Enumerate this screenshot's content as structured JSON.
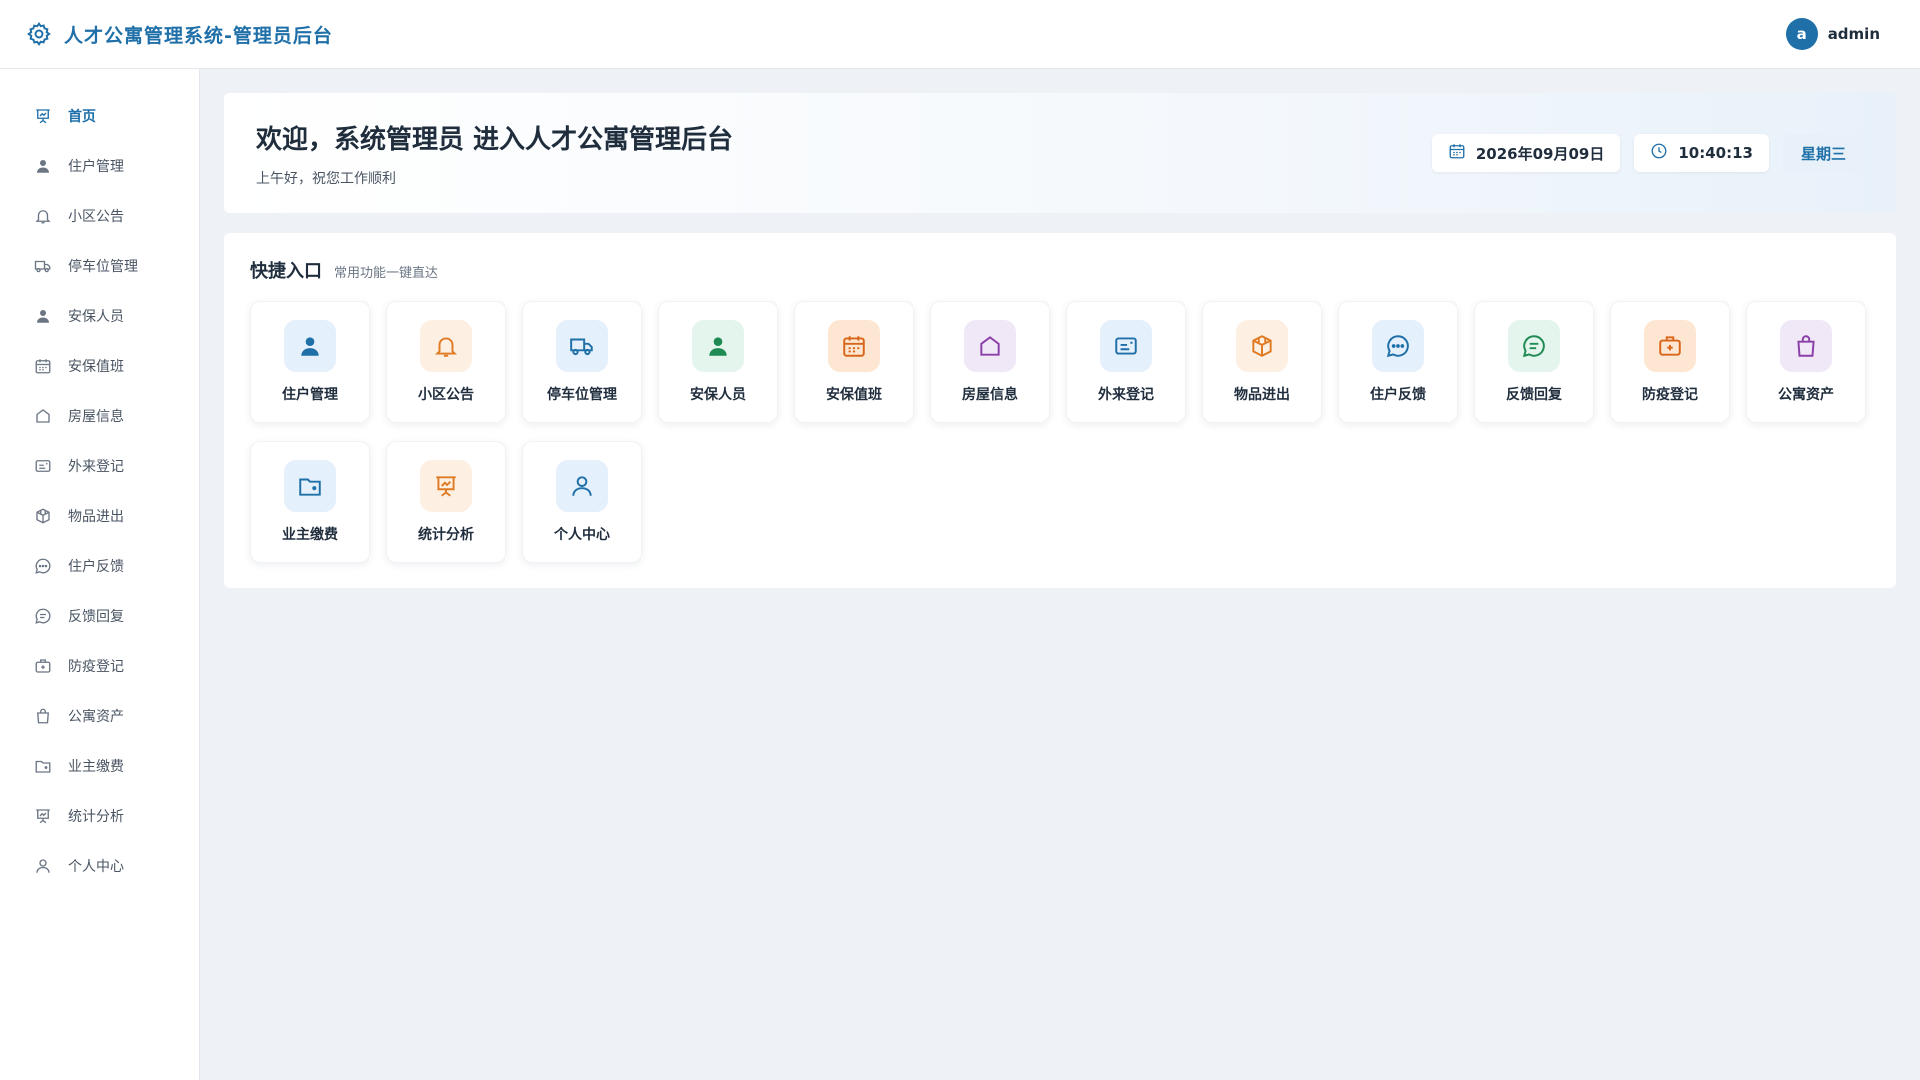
{
  "header": {
    "title": "人才公寓管理系统-管理员后台",
    "avatar_letter": "a",
    "username": "admin"
  },
  "sidebar": {
    "items": [
      {
        "label": "首页",
        "icon": "presentation-icon",
        "active": true
      },
      {
        "label": "住户管理",
        "icon": "user-solid-icon"
      },
      {
        "label": "小区公告",
        "icon": "bell-icon"
      },
      {
        "label": "停车位管理",
        "icon": "truck-icon"
      },
      {
        "label": "安保人员",
        "icon": "user-solid-icon"
      },
      {
        "label": "安保值班",
        "icon": "calendar-icon"
      },
      {
        "label": "房屋信息",
        "icon": "house-icon"
      },
      {
        "label": "外来登记",
        "icon": "id-card-icon"
      },
      {
        "label": "物品进出",
        "icon": "box-icon"
      },
      {
        "label": "住户反馈",
        "icon": "chat-dots-icon"
      },
      {
        "label": "反馈回复",
        "icon": "chat-lines-icon"
      },
      {
        "label": "防疫登记",
        "icon": "medkit-icon"
      },
      {
        "label": "公寓资产",
        "icon": "bag-icon"
      },
      {
        "label": "业主缴费",
        "icon": "wallet-icon"
      },
      {
        "label": "统计分析",
        "icon": "presentation-icon"
      },
      {
        "label": "个人中心",
        "icon": "user-outline-icon"
      }
    ]
  },
  "welcome": {
    "title": "欢迎，系统管理员 进入人才公寓管理后台",
    "subtitle": "上午好，祝您工作顺利",
    "date": "2026年09月09日",
    "time": "10:40:13",
    "weekday": "星期三"
  },
  "quick": {
    "title": "快捷入口",
    "subtitle": "常用功能一键直达",
    "cards": [
      {
        "label": "住户管理",
        "icon": "user-solid-icon",
        "bg": "#e4f0fb",
        "color": "#1f6fa8"
      },
      {
        "label": "小区公告",
        "icon": "bell-icon",
        "bg": "#fdf0e3",
        "color": "#e07b24"
      },
      {
        "label": "停车位管理",
        "icon": "truck-icon",
        "bg": "#e4f0fb",
        "color": "#1f6fa8"
      },
      {
        "label": "安保人员",
        "icon": "user-solid-icon",
        "bg": "#e3f5ec",
        "color": "#1f8a53"
      },
      {
        "label": "安保值班",
        "icon": "calendar-icon",
        "bg": "#fde7d2",
        "color": "#d9651a"
      },
      {
        "label": "房屋信息",
        "icon": "house-icon",
        "bg": "#f1e8f7",
        "color": "#8a3fa8"
      },
      {
        "label": "外来登记",
        "icon": "id-card-icon",
        "bg": "#e4f0fb",
        "color": "#1f6fa8"
      },
      {
        "label": "物品进出",
        "icon": "box-icon",
        "bg": "#fdf0e3",
        "color": "#e07b24"
      },
      {
        "label": "住户反馈",
        "icon": "chat-dots-icon",
        "bg": "#e4f0fb",
        "color": "#1f6fa8"
      },
      {
        "label": "反馈回复",
        "icon": "chat-lines-icon",
        "bg": "#e3f5ec",
        "color": "#1f8a53"
      },
      {
        "label": "防疫登记",
        "icon": "medkit-icon",
        "bg": "#fde7d2",
        "color": "#d9651a"
      },
      {
        "label": "公寓资产",
        "icon": "bag-icon",
        "bg": "#f1e8f7",
        "color": "#8a3fa8"
      },
      {
        "label": "业主缴费",
        "icon": "wallet-icon",
        "bg": "#e4f0fb",
        "color": "#1f6fa8"
      },
      {
        "label": "统计分析",
        "icon": "presentation-icon",
        "bg": "#fdf0e3",
        "color": "#e07b24"
      },
      {
        "label": "个人中心",
        "icon": "user-outline-icon",
        "bg": "#e4f0fb",
        "color": "#1f6fa8"
      }
    ]
  }
}
